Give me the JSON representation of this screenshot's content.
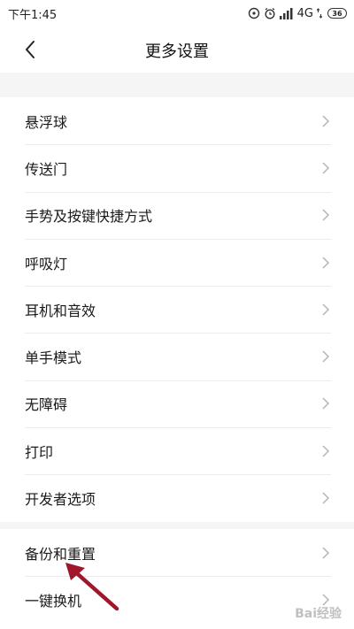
{
  "status_bar": {
    "time": "下午1:45",
    "network": "4G",
    "battery": "36"
  },
  "header": {
    "title": "更多设置",
    "back_icon": "chevron-left-icon"
  },
  "group1": {
    "items": [
      {
        "label": "悬浮球"
      },
      {
        "label": "传送门"
      },
      {
        "label": "手势及按键快捷方式"
      },
      {
        "label": "呼吸灯"
      },
      {
        "label": "耳机和音效"
      },
      {
        "label": "单手模式"
      },
      {
        "label": "无障碍"
      },
      {
        "label": "打印"
      },
      {
        "label": "开发者选项"
      }
    ]
  },
  "group2": {
    "items": [
      {
        "label": "备份和重置"
      },
      {
        "label": "一键换机"
      }
    ]
  },
  "annotation": {
    "arrow_color": "#a0162b"
  },
  "watermark": {
    "text": "Bai经验"
  }
}
